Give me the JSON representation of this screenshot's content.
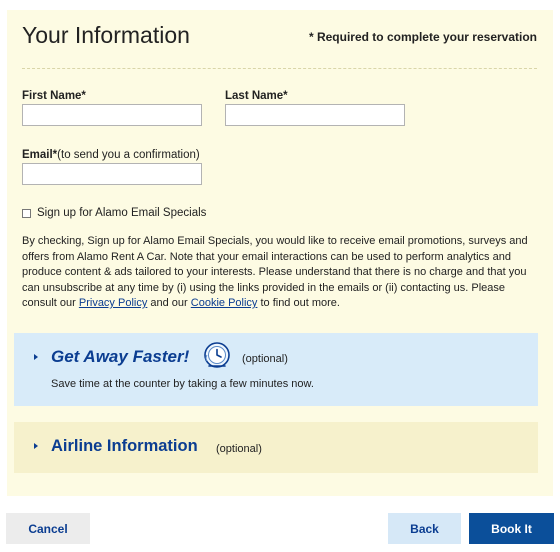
{
  "header": {
    "title": "Your Information",
    "required_note": "* Required to complete your reservation"
  },
  "form": {
    "first_name": {
      "label": "First Name*",
      "value": ""
    },
    "last_name": {
      "label": "Last Name*",
      "value": ""
    },
    "email": {
      "label": "Email*",
      "hint": "(to send you a confirmation)",
      "value": ""
    },
    "email_specials": {
      "label": "Sign up for Alamo Email Specials",
      "checked": false
    },
    "disclaimer": {
      "part1": "By checking, Sign up for Alamo Email Specials, you would like to receive email promotions, surveys and offers from Alamo Rent A Car. Note that your email interactions can be used to perform analytics and produce content & ads tailored to your interests. Please understand that there is no charge and that you can unsubscribe at any time by (i) using the links provided in the emails or (ii) contacting us. Please consult our ",
      "privacy_link": "Privacy Policy",
      "part2": " and our ",
      "cookie_link": "Cookie Policy",
      "part3": " to find out more."
    }
  },
  "get_away_faster": {
    "title": "Get Away Faster!",
    "optional": "(optional)",
    "description": "Save time at the counter by taking a few minutes now.",
    "icon": "clock-icon"
  },
  "airline": {
    "title": "Airline Information",
    "optional": "(optional)"
  },
  "footer": {
    "cancel_label": "Cancel",
    "back_label": "Back",
    "book_label": "Book It"
  },
  "colors": {
    "panel_bg": "#fdfbe3",
    "accent_blue": "#0b3d91",
    "fast_bg": "#d8ebf9",
    "airline_bg": "#f6f1cc",
    "book_bg": "#0b4f9a"
  }
}
